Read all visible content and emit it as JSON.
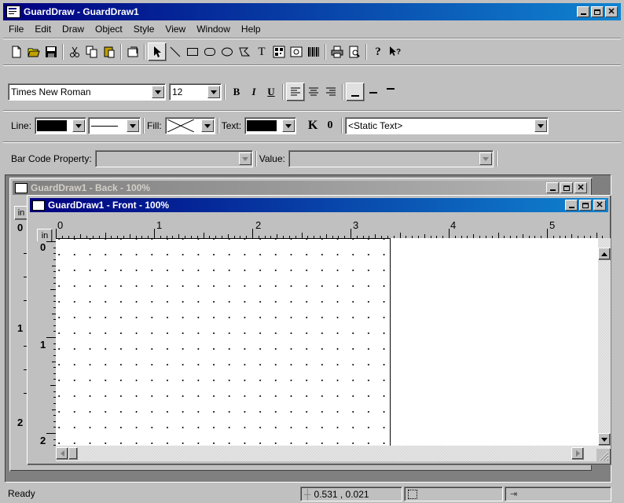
{
  "app": {
    "title": "GuardDraw - GuardDraw1",
    "icon": "app-icon"
  },
  "menu": [
    {
      "label": "File",
      "key": "F"
    },
    {
      "label": "Edit",
      "key": "E"
    },
    {
      "label": "Draw",
      "key": "D"
    },
    {
      "label": "Object",
      "key": "O"
    },
    {
      "label": "Style",
      "key": "S"
    },
    {
      "label": "View",
      "key": "V"
    },
    {
      "label": "Window",
      "key": "W"
    },
    {
      "label": "Help",
      "key": "H"
    }
  ],
  "toolbar": {
    "icons": [
      "new-file-icon",
      "open-folder-icon",
      "save-icon",
      "cut-icon",
      "copy-icon",
      "paste-icon",
      "properties-icon",
      "pointer-icon",
      "line-icon",
      "rectangle-icon",
      "rounded-rectangle-icon",
      "ellipse-icon",
      "polygon-icon",
      "text-icon",
      "barcode-image-icon",
      "picture-icon",
      "barcode-icon",
      "print-icon",
      "print-preview-icon",
      "help-icon",
      "context-help-icon"
    ],
    "text_tool_glyph": "T"
  },
  "format_bar": {
    "font": "Times New Roman",
    "size": "12",
    "bold": "B",
    "italic": "I",
    "underline": "U"
  },
  "style_bar": {
    "line_label": "Line:",
    "fill_label": "Fill:",
    "text_label": "Text:",
    "k_label": "K",
    "zero_label": "0",
    "static_text": "<Static Text>"
  },
  "barcode_bar": {
    "property_label": "Bar Code Property:",
    "value_label": "Value:"
  },
  "back_window": {
    "title": "GuardDraw1 - Back - 100%",
    "unit": "in",
    "ruler_numbers": [
      "0",
      "1",
      "2"
    ]
  },
  "front_window": {
    "title": "GuardDraw1 - Front - 100%",
    "unit": "in",
    "ruler_top": [
      "0",
      "1",
      "2",
      "3",
      "4",
      "5"
    ],
    "ruler_left": [
      "0",
      "1",
      "2"
    ]
  },
  "status": {
    "text": "Ready",
    "coords": "0.531 , 0.021"
  },
  "colors": {
    "title_active": "#000080",
    "title_inactive": "#808080",
    "face": "#c0c0c0"
  }
}
